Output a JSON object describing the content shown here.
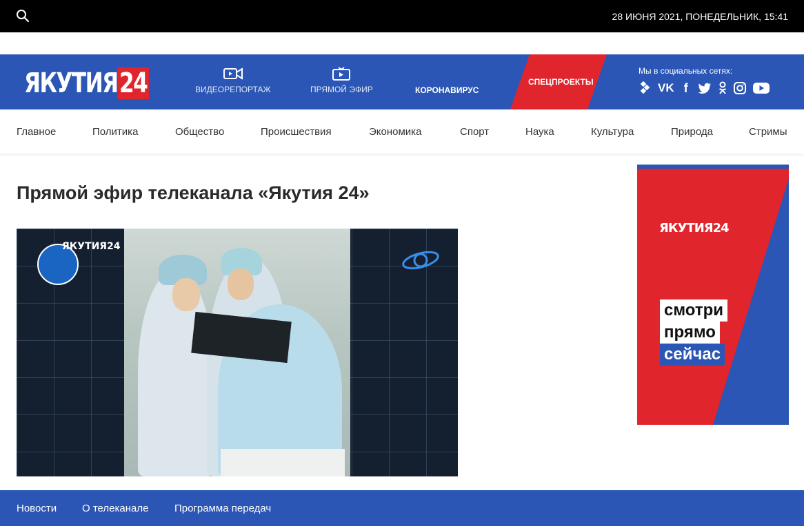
{
  "topbar": {
    "date": "28 ИЮНЯ 2021, ПОНЕДЕЛЬНИК, 15:41"
  },
  "header": {
    "logo_main": "ЯКУТИЯ",
    "logo_num": "24",
    "nav": [
      {
        "label": "ВИДЕОРЕПОРТАЖ",
        "icon": "video-camera-icon"
      },
      {
        "label": "ПРЯМОЙ ЭФИР",
        "icon": "tv-icon"
      },
      {
        "label": "КОРОНАВИРУС"
      }
    ],
    "special_label": "СПЕЦПРОЕКТЫ",
    "social_title": "Мы в социальных сетях:",
    "social": [
      "telegram-icon",
      "vk-icon",
      "facebook-icon",
      "twitter-icon",
      "odnoklassniki-icon",
      "instagram-icon",
      "youtube-icon"
    ]
  },
  "menu": [
    "Главное",
    "Политика",
    "Общество",
    "Происшествия",
    "Экономика",
    "Спорт",
    "Наука",
    "Культура",
    "Природа",
    "Стримы"
  ],
  "main": {
    "title": "Прямой эфир телеканала «Якутия 24»"
  },
  "player": {
    "channel_mark": "ЯКУТИЯ24"
  },
  "banner": {
    "brand": "ЯКУТИЯ24",
    "lines": [
      "смотри",
      "прямо",
      "сейчас"
    ]
  },
  "footer": [
    "Новости",
    "О телеканале",
    "Программа передач"
  ],
  "colors": {
    "brand_blue": "#2b56b5",
    "brand_red": "#e0252c",
    "topbar": "#000000"
  }
}
